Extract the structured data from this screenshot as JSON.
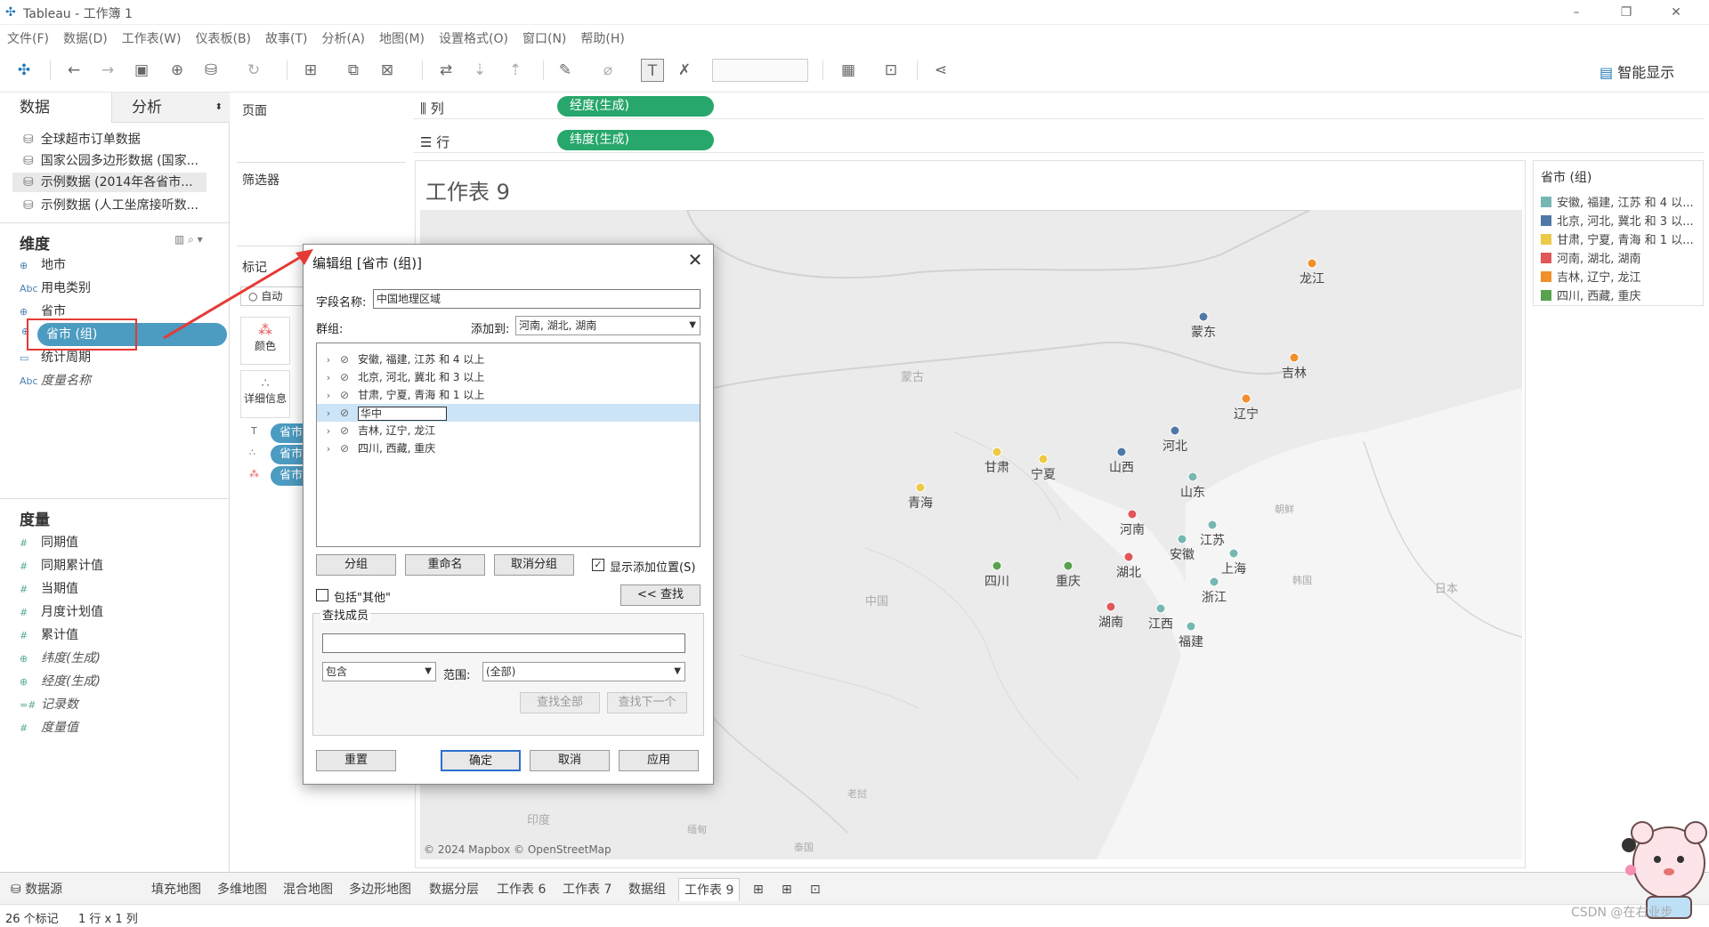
{
  "window": {
    "title": "Tableau - 工作簿 1",
    "minimize": "–",
    "restore": "❐",
    "close": "✕"
  },
  "menu": [
    "文件(F)",
    "数据(D)",
    "工作表(W)",
    "仪表板(B)",
    "故事(T)",
    "分析(A)",
    "地图(M)",
    "设置格式(O)",
    "窗口(N)",
    "帮助(H)"
  ],
  "toolbar": {
    "smart_show": "智能显示"
  },
  "left_panel": {
    "tab_data": "数据",
    "tab_analysis": "分析",
    "sources": [
      "全球超市订单数据",
      "国家公园多边形数据 (国家...",
      "示例数据 (2014年各省市...",
      "示例数据 (人工坐席接听数..."
    ],
    "dimensions_header": "维度",
    "dimensions": [
      {
        "icon": "⊕",
        "label": "地市"
      },
      {
        "icon": "Abc",
        "label": "用电类别"
      },
      {
        "icon": "⊕",
        "label": "省市"
      },
      {
        "icon": "⊕",
        "label": "省市 (组)"
      },
      {
        "icon": "▭",
        "label": "统计周期"
      },
      {
        "icon": "Abc",
        "label": "度量名称"
      }
    ],
    "measures_header": "度量",
    "measures": [
      {
        "icon": "#",
        "label": "同期值"
      },
      {
        "icon": "#",
        "label": "同期累计值"
      },
      {
        "icon": "#",
        "label": "当期值"
      },
      {
        "icon": "#",
        "label": "月度计划值"
      },
      {
        "icon": "#",
        "label": "累计值"
      },
      {
        "icon": "⊕",
        "label": "纬度(生成)"
      },
      {
        "icon": "⊕",
        "label": "经度(生成)"
      },
      {
        "icon": "=#",
        "label": "记录数"
      },
      {
        "icon": "#",
        "label": "度量值"
      }
    ]
  },
  "cards": {
    "pages": "页面",
    "filters": "筛选器",
    "marks": "标记",
    "marks_type": "自动",
    "color": "颜色",
    "detail": "详细信息",
    "mark_pills": [
      "省市",
      "省市",
      "省市"
    ]
  },
  "shelves": {
    "columns_label": "列",
    "columns_pill": "经度(生成)",
    "rows_label": "行",
    "rows_pill": "纬度(生成)"
  },
  "view": {
    "sheet_title": "工作表 9",
    "copyright": "© 2024 Mapbox © OpenStreetMap",
    "map_labels": [
      "蒙古",
      "中国",
      "朝鲜",
      "韩国",
      "日本",
      "印度",
      "缅甸",
      "泰国",
      "老挝"
    ]
  },
  "map_points": [
    {
      "name": "龙江",
      "color": "#f28e2b"
    },
    {
      "name": "蒙东",
      "color": "#4e79a7"
    },
    {
      "name": "吉林",
      "color": "#f28e2b"
    },
    {
      "name": "辽宁",
      "color": "#f28e2b"
    },
    {
      "name": "河北",
      "color": "#4e79a7"
    },
    {
      "name": "山西",
      "color": "#4e79a7"
    },
    {
      "name": "甘肃",
      "color": "#edc948"
    },
    {
      "name": "宁夏",
      "color": "#edc948"
    },
    {
      "name": "山东",
      "color": "#76b7b2"
    },
    {
      "name": "青海",
      "color": "#edc948"
    },
    {
      "name": "河南",
      "color": "#e15759"
    },
    {
      "name": "江苏",
      "color": "#76b7b2"
    },
    {
      "name": "安徽",
      "color": "#76b7b2"
    },
    {
      "name": "上海",
      "color": "#76b7b2"
    },
    {
      "name": "湖北",
      "color": "#e15759"
    },
    {
      "name": "四川",
      "color": "#59a14f"
    },
    {
      "name": "重庆",
      "color": "#59a14f"
    },
    {
      "name": "浙江",
      "color": "#76b7b2"
    },
    {
      "name": "湖南",
      "color": "#e15759"
    },
    {
      "name": "江西",
      "color": "#76b7b2"
    },
    {
      "name": "福建",
      "color": "#76b7b2"
    }
  ],
  "legend": {
    "title": "省市 (组)",
    "items": [
      {
        "label": "安徽, 福建, 江苏 和 4 以...",
        "color": "#76b7b2"
      },
      {
        "label": "北京, 河北, 冀北 和 3 以...",
        "color": "#4e79a7"
      },
      {
        "label": "甘肃, 宁夏, 青海 和 1 以...",
        "color": "#edc948"
      },
      {
        "label": "河南, 湖北, 湖南",
        "color": "#e15759"
      },
      {
        "label": "吉林, 辽宁, 龙江",
        "color": "#f28e2b"
      },
      {
        "label": "四川, 西藏, 重庆",
        "color": "#59a14f"
      }
    ]
  },
  "bottom_tabs": [
    "数据源",
    "填充地图",
    "多维地图",
    "混合地图",
    "多边形地图",
    "数据分层",
    "工作表 6",
    "工作表 7",
    "数据组",
    "工作表 9"
  ],
  "status": {
    "marks": "26 个标记",
    "rows_cols": "1 行 x 1 列"
  },
  "dialog": {
    "title": "编辑组 [省市 (组)]",
    "field_name_label": "字段名称:",
    "field_name_value": "中国地理区域",
    "groups_label": "群组:",
    "add_to_label": "添加到:",
    "add_to_value": "河南, 湖北, 湖南",
    "groups": [
      {
        "label": "安徽, 福建, 江苏 和 4 以上",
        "editing": false
      },
      {
        "label": "北京, 河北, 冀北 和 3 以上",
        "editing": false
      },
      {
        "label": "甘肃, 宁夏, 青海 和 1 以上",
        "editing": false
      },
      {
        "label": "华中",
        "editing": true
      },
      {
        "label": "吉林, 辽宁, 龙江",
        "editing": false
      },
      {
        "label": "四川, 西藏, 重庆",
        "editing": false
      }
    ],
    "btn_group": "分组",
    "btn_rename": "重命名",
    "btn_ungroup": "取消分组",
    "show_add_location": "显示添加位置(S)",
    "include_other": "包括\"其他\"",
    "btn_find": "<< 查找",
    "find_members": "查找成员",
    "find_mode": "包含",
    "scope_label": "范围:",
    "scope_value": "(全部)",
    "btn_find_all": "查找全部",
    "btn_find_next": "查找下一个",
    "btn_reset": "重置",
    "btn_ok": "确定",
    "btn_cancel": "取消",
    "btn_apply": "应用"
  },
  "watermark": "CSDN @在右业步"
}
